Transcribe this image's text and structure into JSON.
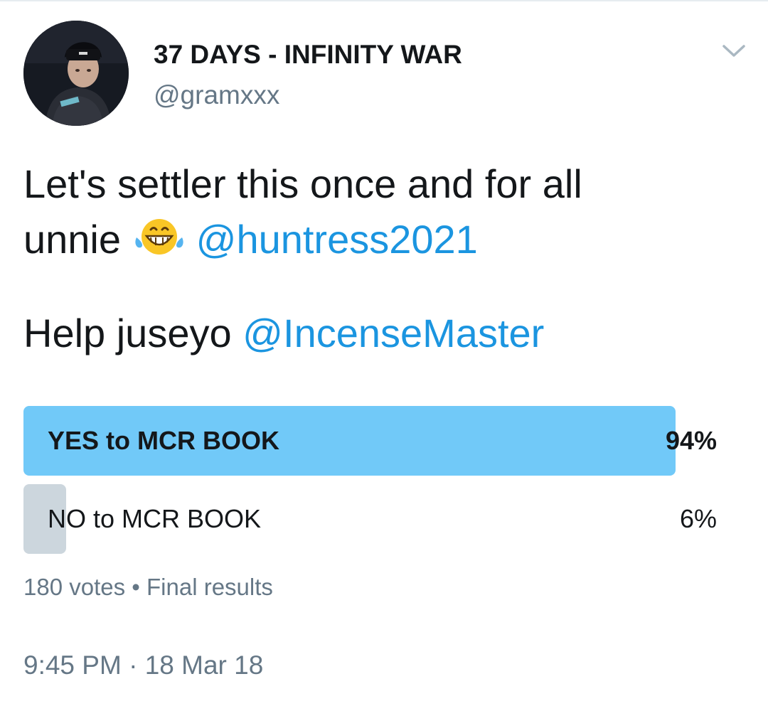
{
  "author": {
    "display_name": "37 DAYS - INFINITY WAR",
    "handle": "@gramxxx"
  },
  "tweet": {
    "line1": "Let's settler this once and for all",
    "line2_text": "unnie",
    "line2_emoji": "grinning-squinting-face-with-tears-of-joy",
    "mention1": "@huntress2021",
    "line3_text": "Help juseyo",
    "mention2": "@IncenseMaster"
  },
  "poll": {
    "options": [
      {
        "label": "YES to MCR BOOK",
        "percent_label": "94%",
        "percent": 94,
        "winner": true
      },
      {
        "label": "NO to MCR BOOK",
        "percent_label": "6%",
        "percent": 6,
        "winner": false
      }
    ],
    "votes": "180 votes",
    "separator": "•",
    "status": "Final results"
  },
  "timestamp": {
    "time": "9:45 PM",
    "separator": "·",
    "date": "18 Mar 18"
  },
  "colors": {
    "mention": "#1b95e0",
    "poll_winner": "#71c9f8",
    "poll_other": "#ccd6dd",
    "muted_text": "#657786"
  },
  "icons": {
    "menu": "chevron-down-icon",
    "emoji": "laughing-emoji-icon"
  }
}
